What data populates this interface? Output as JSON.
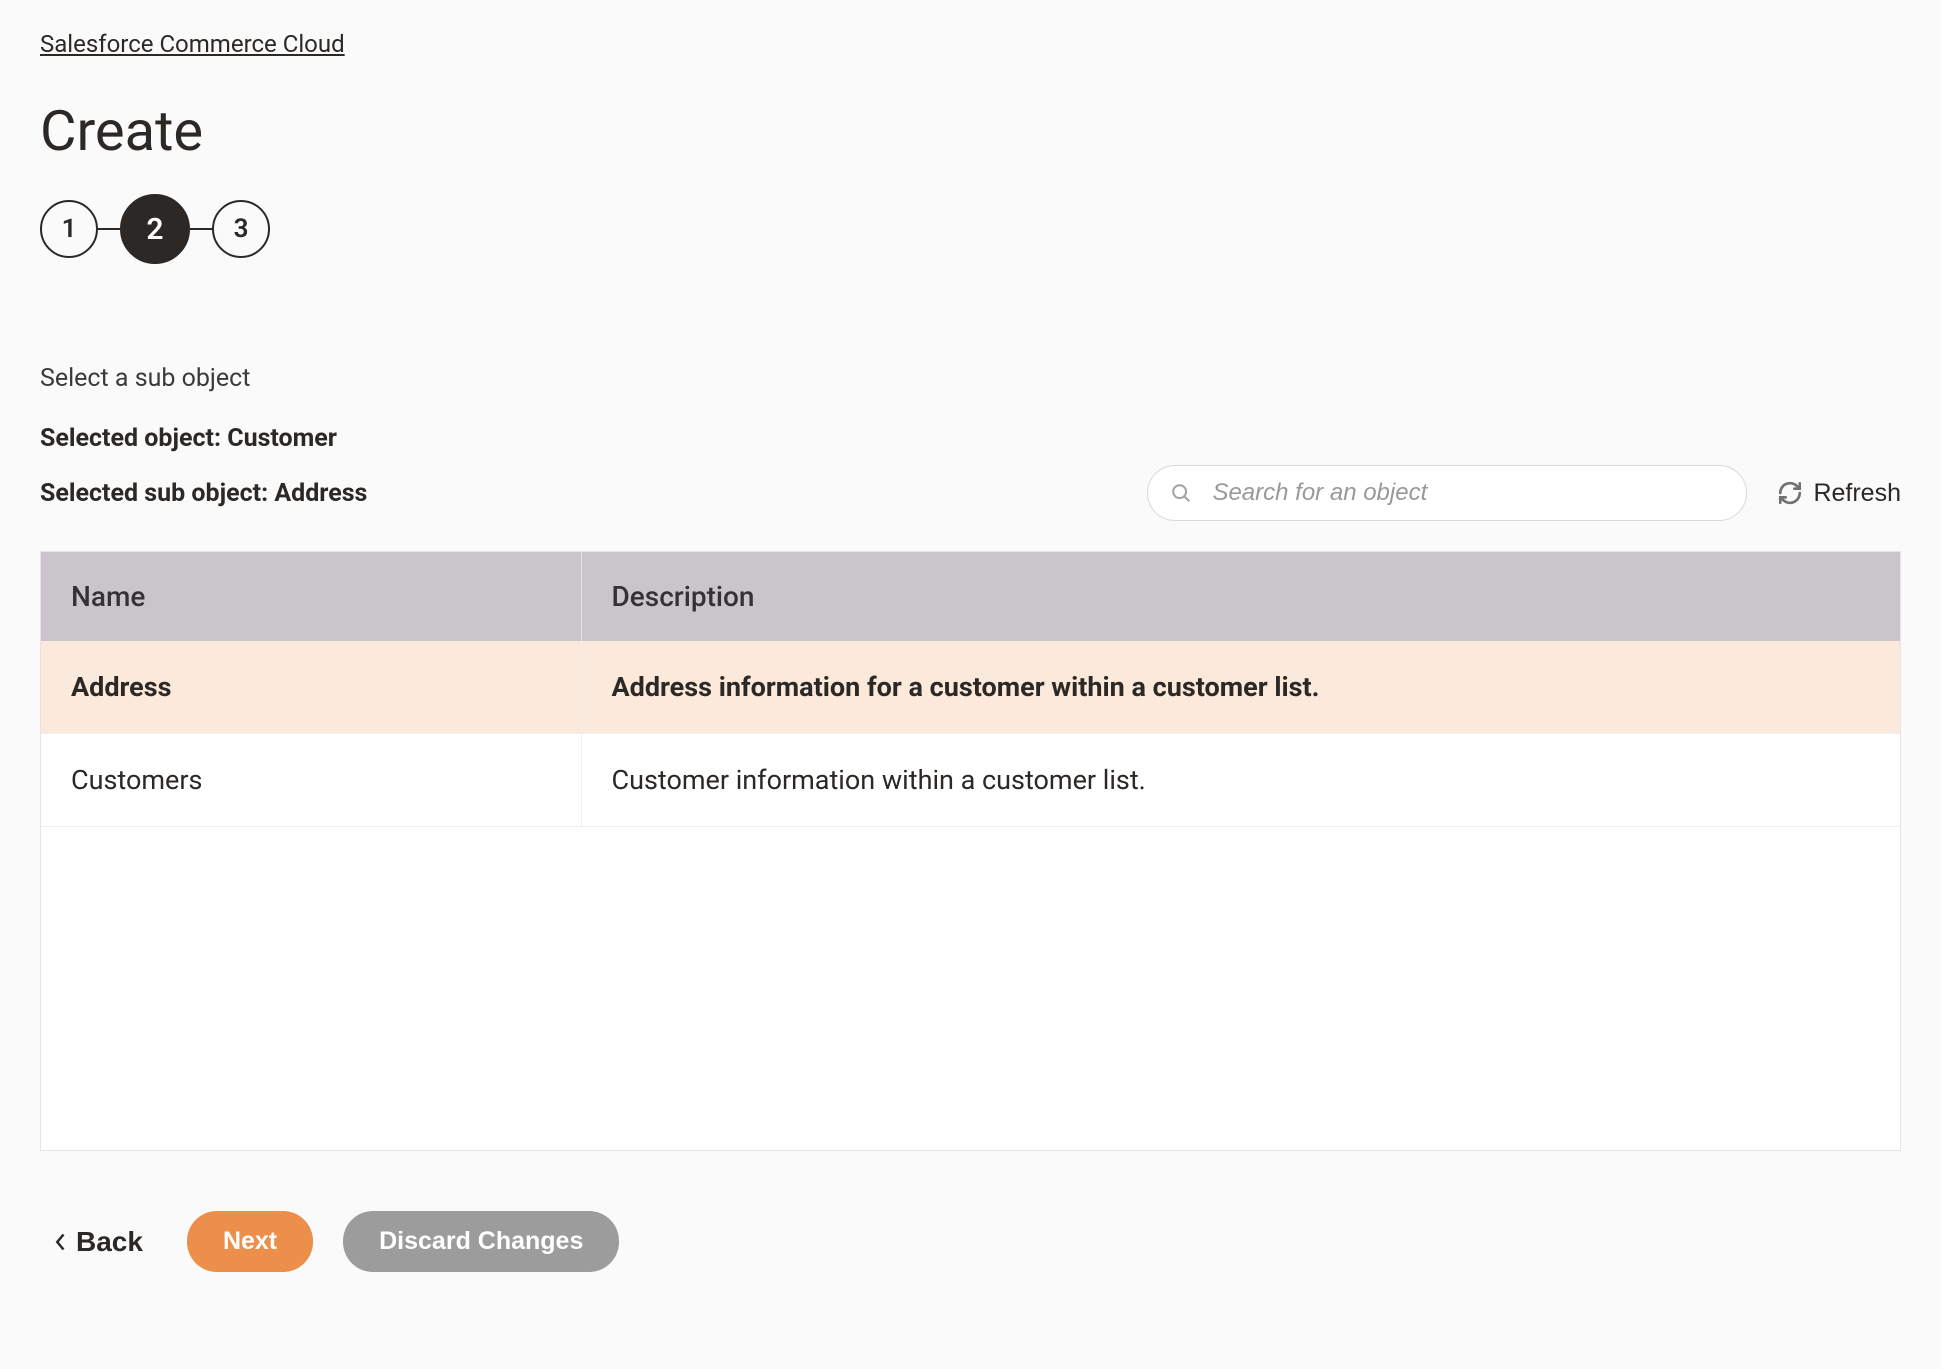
{
  "breadcrumb": "Salesforce Commerce Cloud",
  "title": "Create",
  "steps": {
    "s1": "1",
    "s2": "2",
    "s3": "3",
    "active": 2
  },
  "instruction": "Select a sub object",
  "selected_object_label": "Selected object: Customer",
  "selected_sub_object_label": "Selected sub object: Address",
  "search": {
    "placeholder": "Search for an object"
  },
  "refresh_label": "Refresh",
  "table": {
    "headers": {
      "name": "Name",
      "description": "Description"
    },
    "rows": [
      {
        "name": "Address",
        "description": "Address information for a customer within a customer list.",
        "selected": true
      },
      {
        "name": "Customers",
        "description": "Customer information within a customer list.",
        "selected": false
      }
    ]
  },
  "buttons": {
    "back": "Back",
    "next": "Next",
    "discard": "Discard Changes"
  }
}
